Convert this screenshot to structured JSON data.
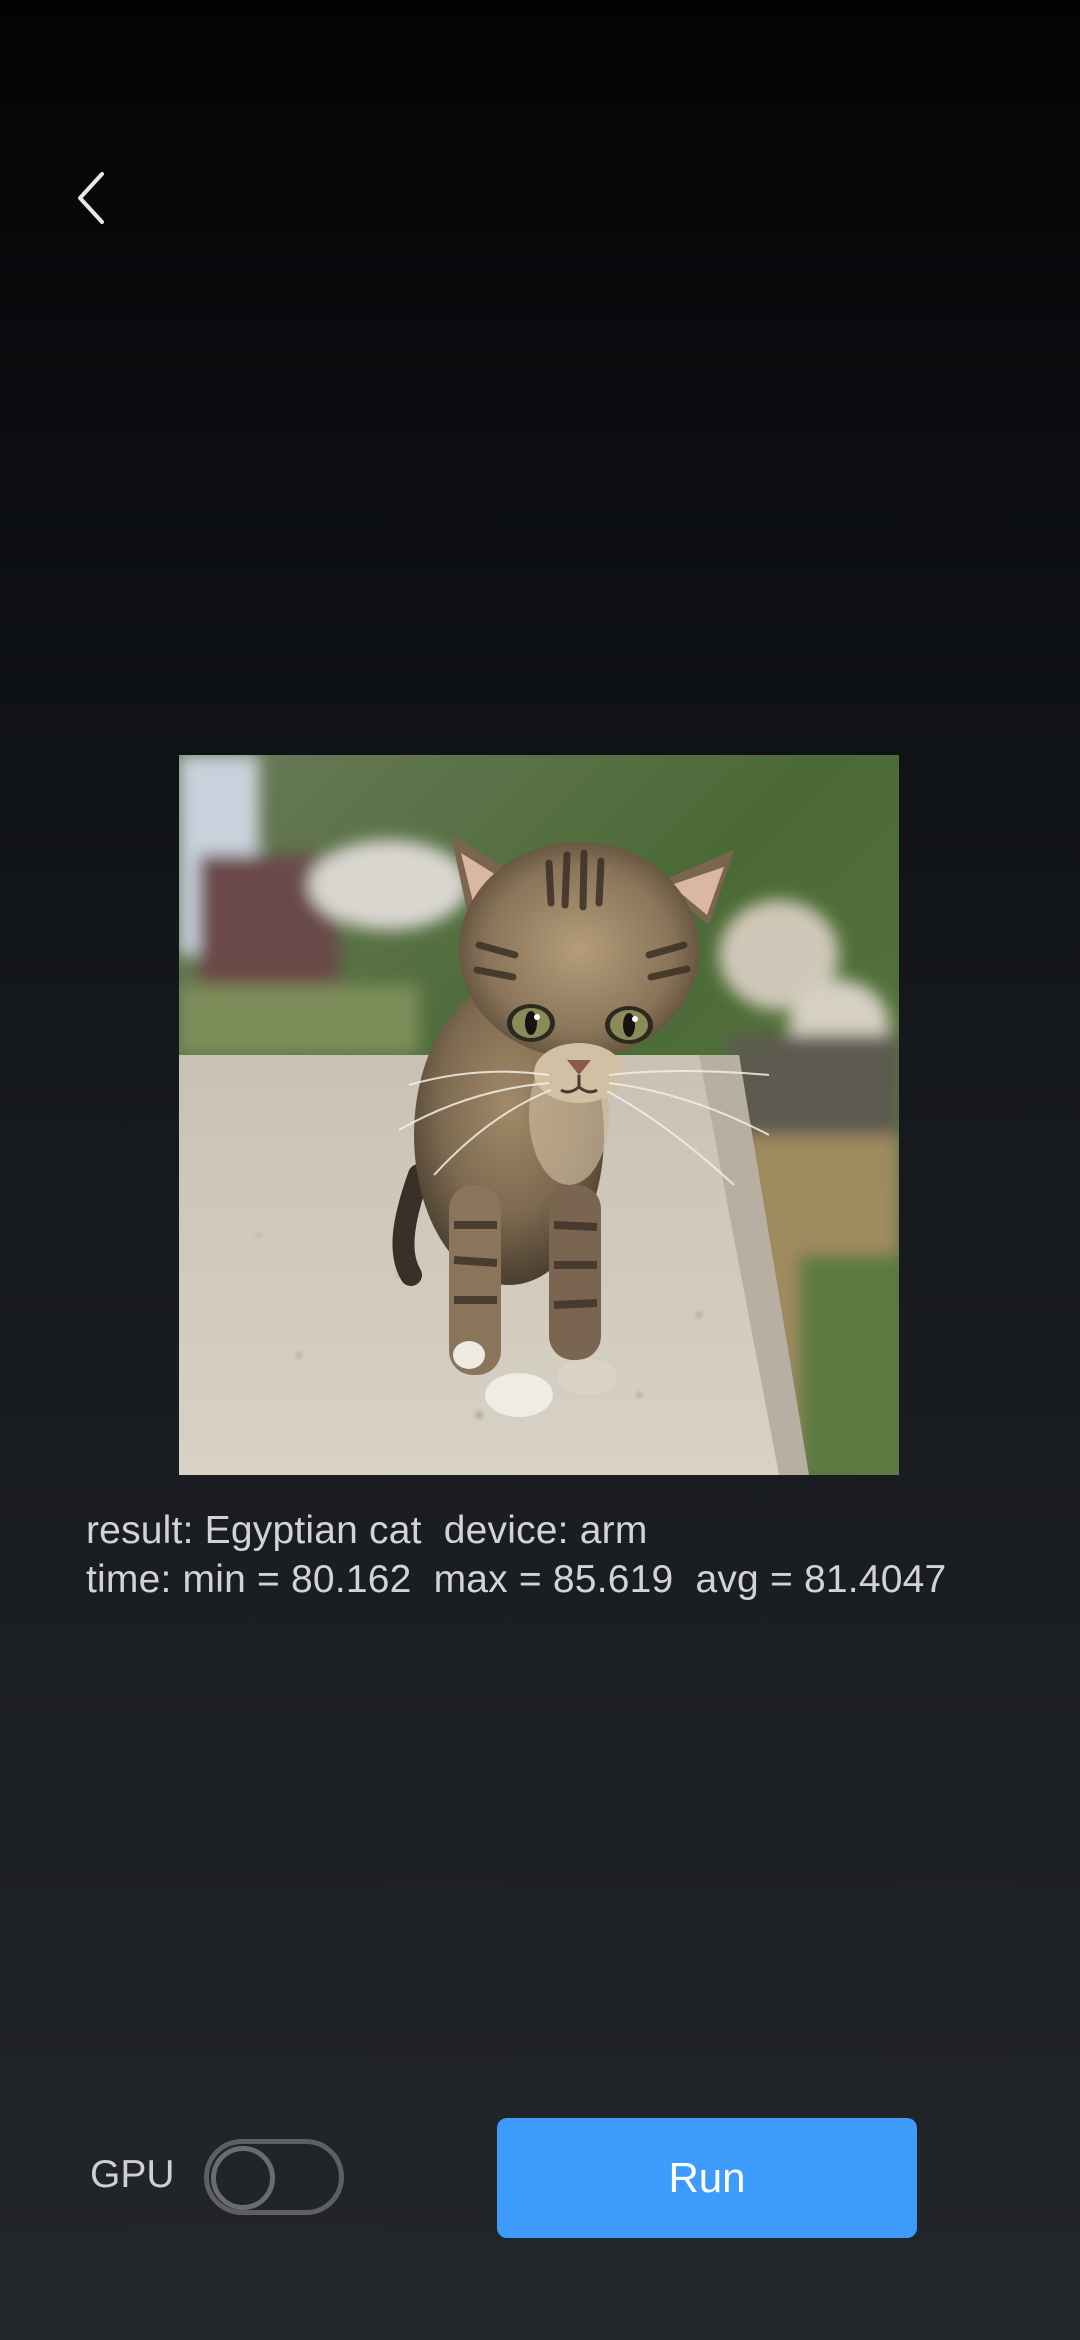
{
  "nav": {
    "back_icon": "chevron-left-icon"
  },
  "image": {
    "subject": "tabby-kitten-photo"
  },
  "result": {
    "line1": "result: Egyptian cat  device: arm",
    "line2": "time: min = 80.162  max = 85.619  avg = 81.4047"
  },
  "controls": {
    "gpu_label": "GPU",
    "gpu_enabled": false,
    "run_label": "Run"
  },
  "colors": {
    "accent": "#3d9bfb",
    "text": "#d3d3d3"
  }
}
